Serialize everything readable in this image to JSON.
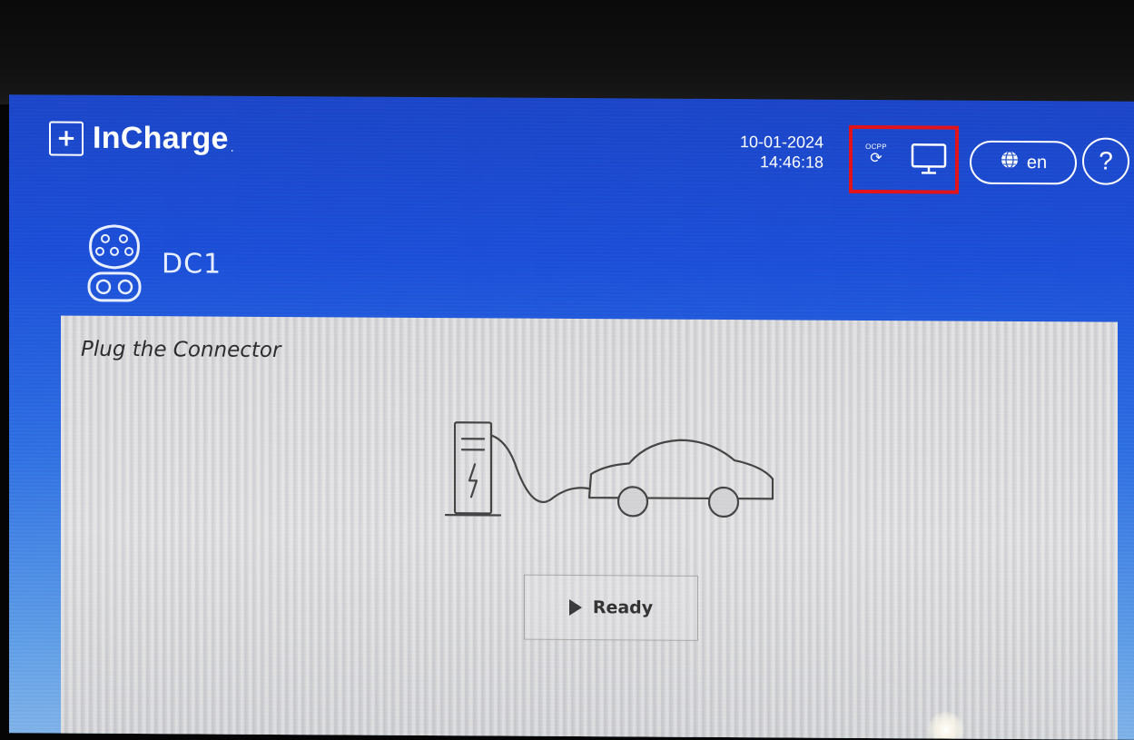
{
  "header": {
    "brand": "InCharge",
    "brand_mark": "+",
    "brand_suffix": ".",
    "date": "10-01-2024",
    "time": "14:46:18",
    "ocpp_label": "OCPP",
    "ocpp_icon": "sync-icon",
    "screen_icon": "monitor-icon",
    "language": "en",
    "language_icon": "globe-icon",
    "help": "?"
  },
  "connector": {
    "name": "DC1",
    "icon": "ccs-connector-icon"
  },
  "panel": {
    "title": "Plug the Connector",
    "illustration_icon": "charger-car-icon",
    "status": "Ready",
    "status_icon": "play-icon"
  },
  "colors": {
    "screen_top": "#1c46c8",
    "screen_bottom": "#7fb2e8",
    "highlight": "#e2131a",
    "panel": "#d2d2d4"
  }
}
